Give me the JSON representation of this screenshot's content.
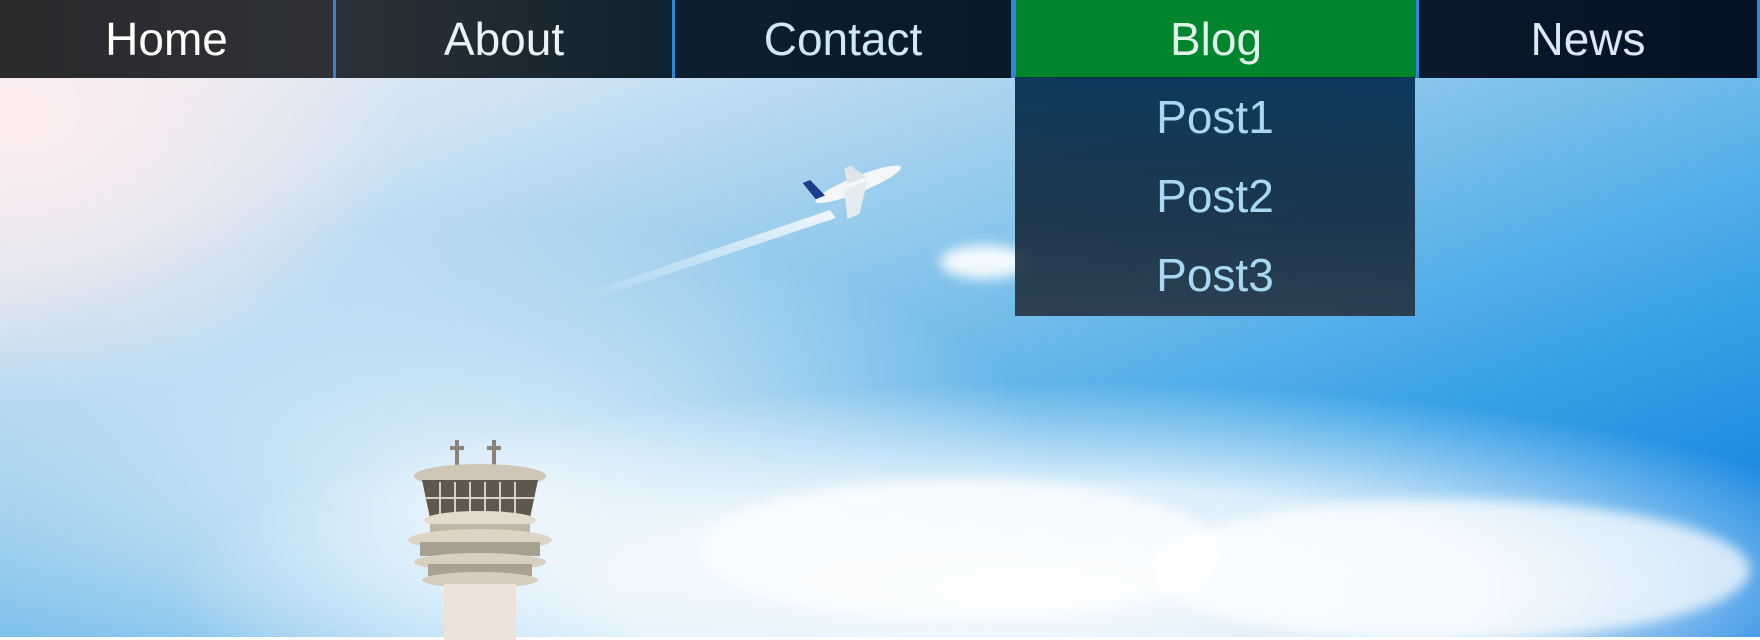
{
  "nav": {
    "items": [
      {
        "label": "Home"
      },
      {
        "label": "About"
      },
      {
        "label": "Contact"
      },
      {
        "label": "Blog",
        "active": true
      },
      {
        "label": "News"
      }
    ],
    "active_color": "#00842c",
    "border_color": "#2c88d6"
  },
  "dropdown": {
    "parent": "Blog",
    "items": [
      {
        "label": "Post1"
      },
      {
        "label": "Post2"
      },
      {
        "label": "Post3"
      }
    ],
    "text_color": "#a9d8f2"
  },
  "hero": {
    "scene": [
      "airplane-icon",
      "control-tower-icon",
      "clouds"
    ],
    "sky_color": "#0577de"
  }
}
